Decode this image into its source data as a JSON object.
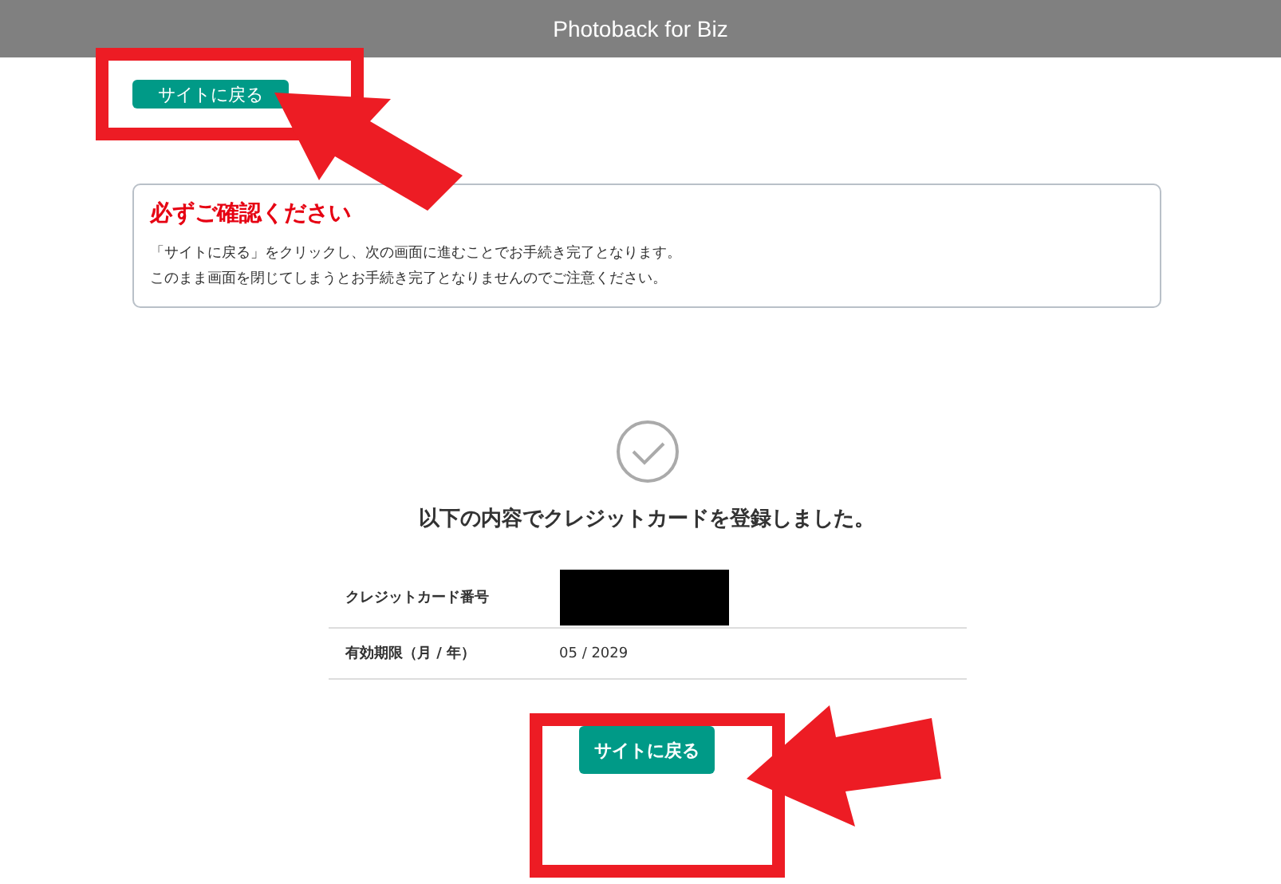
{
  "header": {
    "title": "Photoback for Biz"
  },
  "top_button": {
    "label": "サイトに戻る"
  },
  "notice": {
    "title": "必ずご確認ください",
    "lines": [
      "「サイトに戻る」をクリックし、次の画面に進むことでお手続き完了となります。",
      "このまま画面を閉じてしまうとお手続き完了となりませんのでご注意ください。"
    ]
  },
  "message": "以下の内容でクレジットカードを登録しました。",
  "details": [
    {
      "label": "クレジットカード番号",
      "kind": "redacted"
    },
    {
      "label": "有効期限（月 / 年）",
      "kind": "text",
      "value": "05 / 2029"
    }
  ],
  "bottom_button": {
    "label": "サイトに戻る"
  }
}
